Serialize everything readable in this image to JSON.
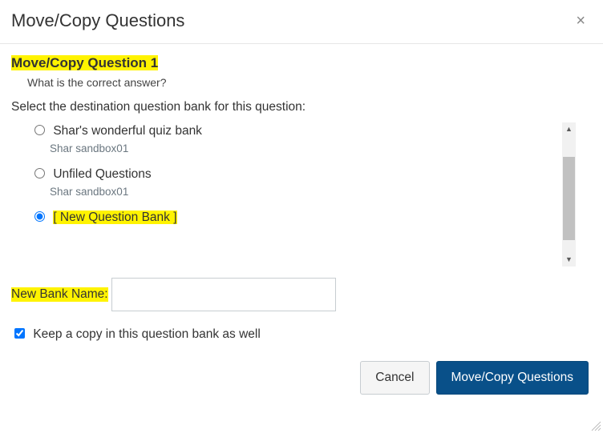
{
  "header": {
    "title": "Move/Copy Questions",
    "close": "×"
  },
  "section": {
    "heading": "Move/Copy Question 1",
    "question_text": "What is the correct answer?",
    "select_label": "Select the destination question bank for this question:"
  },
  "banks": [
    {
      "label": "Shar's wonderful quiz bank",
      "sub": "Shar sandbox01",
      "selected": false,
      "highlight": false
    },
    {
      "label": "Unfiled Questions",
      "sub": "Shar sandbox01",
      "selected": false,
      "highlight": false
    },
    {
      "label": "[ New Question Bank ]",
      "sub": "",
      "selected": true,
      "highlight": true
    }
  ],
  "scroll_arrows": {
    "up": "▲",
    "down": "▼"
  },
  "new_bank": {
    "label": "New Bank Name:",
    "value": ""
  },
  "keep_copy": {
    "label": "Keep a copy in this question bank as well",
    "checked": true
  },
  "footer": {
    "cancel": "Cancel",
    "submit": "Move/Copy Questions"
  }
}
